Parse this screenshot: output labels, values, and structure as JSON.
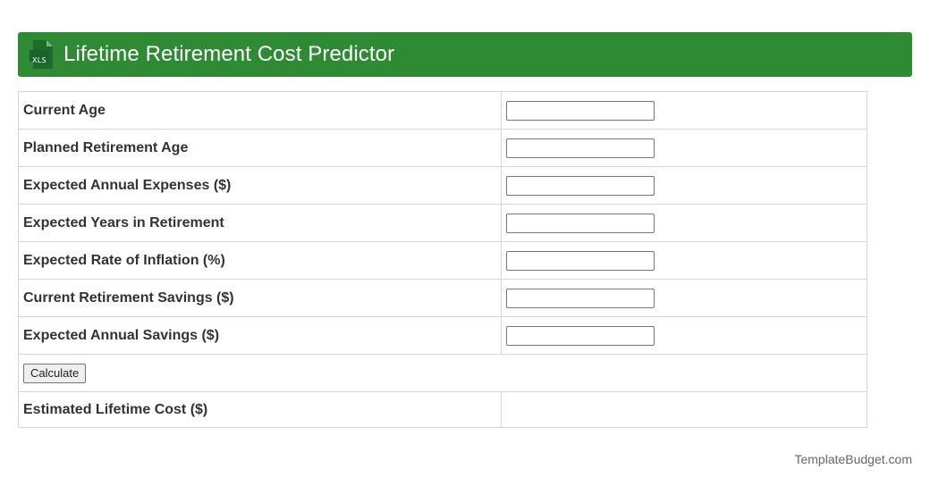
{
  "header": {
    "icon": "xls-file-icon",
    "icon_text": "XLS",
    "title": "Lifetime Retirement Cost Predictor",
    "background": "#2e8b34"
  },
  "form": {
    "fields": [
      {
        "label": "Current Age",
        "value": ""
      },
      {
        "label": "Planned Retirement Age",
        "value": ""
      },
      {
        "label": "Expected Annual Expenses ($)",
        "value": ""
      },
      {
        "label": "Expected Years in Retirement",
        "value": ""
      },
      {
        "label": "Expected Rate of Inflation (%)",
        "value": ""
      },
      {
        "label": "Current Retirement Savings ($)",
        "value": ""
      },
      {
        "label": "Expected Annual Savings ($)",
        "value": ""
      }
    ],
    "calculate_label": "Calculate",
    "result_label": "Estimated Lifetime Cost ($)",
    "result_value": ""
  },
  "footer": {
    "text": "TemplateBudget.com"
  }
}
